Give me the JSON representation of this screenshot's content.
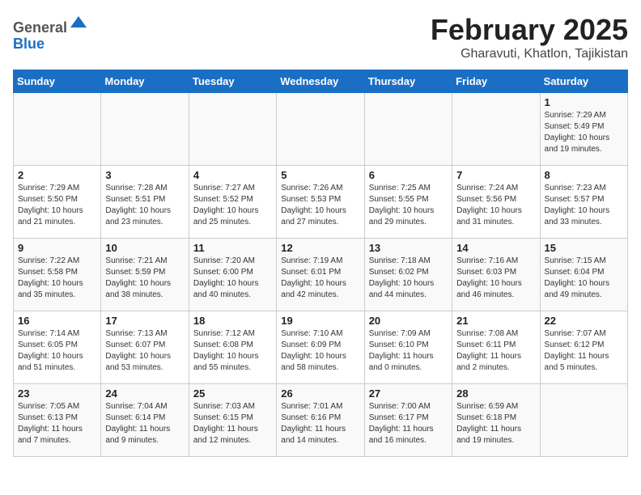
{
  "header": {
    "logo_general": "General",
    "logo_blue": "Blue",
    "month_title": "February 2025",
    "location": "Gharavuti, Khatlon, Tajikistan"
  },
  "weekdays": [
    "Sunday",
    "Monday",
    "Tuesday",
    "Wednesday",
    "Thursday",
    "Friday",
    "Saturday"
  ],
  "weeks": [
    [
      {
        "day": "",
        "info": ""
      },
      {
        "day": "",
        "info": ""
      },
      {
        "day": "",
        "info": ""
      },
      {
        "day": "",
        "info": ""
      },
      {
        "day": "",
        "info": ""
      },
      {
        "day": "",
        "info": ""
      },
      {
        "day": "1",
        "info": "Sunrise: 7:29 AM\nSunset: 5:49 PM\nDaylight: 10 hours\nand 19 minutes."
      }
    ],
    [
      {
        "day": "2",
        "info": "Sunrise: 7:29 AM\nSunset: 5:50 PM\nDaylight: 10 hours\nand 21 minutes."
      },
      {
        "day": "3",
        "info": "Sunrise: 7:28 AM\nSunset: 5:51 PM\nDaylight: 10 hours\nand 23 minutes."
      },
      {
        "day": "4",
        "info": "Sunrise: 7:27 AM\nSunset: 5:52 PM\nDaylight: 10 hours\nand 25 minutes."
      },
      {
        "day": "5",
        "info": "Sunrise: 7:26 AM\nSunset: 5:53 PM\nDaylight: 10 hours\nand 27 minutes."
      },
      {
        "day": "6",
        "info": "Sunrise: 7:25 AM\nSunset: 5:55 PM\nDaylight: 10 hours\nand 29 minutes."
      },
      {
        "day": "7",
        "info": "Sunrise: 7:24 AM\nSunset: 5:56 PM\nDaylight: 10 hours\nand 31 minutes."
      },
      {
        "day": "8",
        "info": "Sunrise: 7:23 AM\nSunset: 5:57 PM\nDaylight: 10 hours\nand 33 minutes."
      }
    ],
    [
      {
        "day": "9",
        "info": "Sunrise: 7:22 AM\nSunset: 5:58 PM\nDaylight: 10 hours\nand 35 minutes."
      },
      {
        "day": "10",
        "info": "Sunrise: 7:21 AM\nSunset: 5:59 PM\nDaylight: 10 hours\nand 38 minutes."
      },
      {
        "day": "11",
        "info": "Sunrise: 7:20 AM\nSunset: 6:00 PM\nDaylight: 10 hours\nand 40 minutes."
      },
      {
        "day": "12",
        "info": "Sunrise: 7:19 AM\nSunset: 6:01 PM\nDaylight: 10 hours\nand 42 minutes."
      },
      {
        "day": "13",
        "info": "Sunrise: 7:18 AM\nSunset: 6:02 PM\nDaylight: 10 hours\nand 44 minutes."
      },
      {
        "day": "14",
        "info": "Sunrise: 7:16 AM\nSunset: 6:03 PM\nDaylight: 10 hours\nand 46 minutes."
      },
      {
        "day": "15",
        "info": "Sunrise: 7:15 AM\nSunset: 6:04 PM\nDaylight: 10 hours\nand 49 minutes."
      }
    ],
    [
      {
        "day": "16",
        "info": "Sunrise: 7:14 AM\nSunset: 6:05 PM\nDaylight: 10 hours\nand 51 minutes."
      },
      {
        "day": "17",
        "info": "Sunrise: 7:13 AM\nSunset: 6:07 PM\nDaylight: 10 hours\nand 53 minutes."
      },
      {
        "day": "18",
        "info": "Sunrise: 7:12 AM\nSunset: 6:08 PM\nDaylight: 10 hours\nand 55 minutes."
      },
      {
        "day": "19",
        "info": "Sunrise: 7:10 AM\nSunset: 6:09 PM\nDaylight: 10 hours\nand 58 minutes."
      },
      {
        "day": "20",
        "info": "Sunrise: 7:09 AM\nSunset: 6:10 PM\nDaylight: 11 hours\nand 0 minutes."
      },
      {
        "day": "21",
        "info": "Sunrise: 7:08 AM\nSunset: 6:11 PM\nDaylight: 11 hours\nand 2 minutes."
      },
      {
        "day": "22",
        "info": "Sunrise: 7:07 AM\nSunset: 6:12 PM\nDaylight: 11 hours\nand 5 minutes."
      }
    ],
    [
      {
        "day": "23",
        "info": "Sunrise: 7:05 AM\nSunset: 6:13 PM\nDaylight: 11 hours\nand 7 minutes."
      },
      {
        "day": "24",
        "info": "Sunrise: 7:04 AM\nSunset: 6:14 PM\nDaylight: 11 hours\nand 9 minutes."
      },
      {
        "day": "25",
        "info": "Sunrise: 7:03 AM\nSunset: 6:15 PM\nDaylight: 11 hours\nand 12 minutes."
      },
      {
        "day": "26",
        "info": "Sunrise: 7:01 AM\nSunset: 6:16 PM\nDaylight: 11 hours\nand 14 minutes."
      },
      {
        "day": "27",
        "info": "Sunrise: 7:00 AM\nSunset: 6:17 PM\nDaylight: 11 hours\nand 16 minutes."
      },
      {
        "day": "28",
        "info": "Sunrise: 6:59 AM\nSunset: 6:18 PM\nDaylight: 11 hours\nand 19 minutes."
      },
      {
        "day": "",
        "info": ""
      }
    ]
  ]
}
